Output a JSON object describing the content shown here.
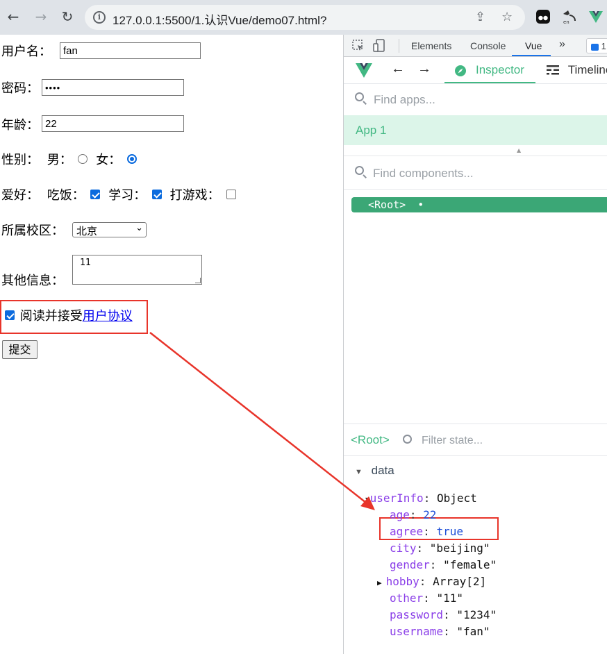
{
  "browser": {
    "url_prefix": "127.0.0.1",
    "url_rest": ":5500/1.认识Vue/demo07.html?"
  },
  "form": {
    "username_label": "用户名：",
    "username_value": "fan",
    "password_label": "密码：",
    "password_value": "••••",
    "age_label": "年龄：",
    "age_value": "22",
    "gender_label": "性别：",
    "male_label": "男：",
    "female_label": "女：",
    "gender_selected": "female",
    "hobby_label": "爱好：",
    "hobbies": [
      {
        "label": "吃饭：",
        "checked": true
      },
      {
        "label": "学习：",
        "checked": true
      },
      {
        "label": "打游戏：",
        "checked": false
      }
    ],
    "campus_label": "所属校区：",
    "campus_value": "北京",
    "other_label": "其他信息：",
    "other_value": "11",
    "agree_text": "阅读并接受",
    "agree_link": "用户协议",
    "agree_checked": true,
    "submit_label": "提交"
  },
  "devtools": {
    "tabs": [
      "Elements",
      "Console",
      "Vue"
    ],
    "more_icon": "»",
    "badge": "1",
    "active_tab": "Vue",
    "vue": {
      "inspector_label": "Inspector",
      "timeline_label": "Timeline",
      "find_apps_placeholder": "Find apps...",
      "app_name": "App 1",
      "find_components_placeholder": "Find components...",
      "root_component": "<Root>",
      "root_dot": "•",
      "selected_component": "<Root>",
      "filter_placeholder": "Filter state...",
      "section": "data",
      "object_key": "userInfo",
      "object_type": "Object",
      "fields": [
        {
          "key": "age",
          "value": "22",
          "kind": "num"
        },
        {
          "key": "agree",
          "value": "true",
          "kind": "bool"
        },
        {
          "key": "city",
          "value": "\"beijing\"",
          "kind": "str"
        },
        {
          "key": "gender",
          "value": "\"female\"",
          "kind": "str"
        },
        {
          "key": "hobby",
          "value": "Array[2]",
          "kind": "arr"
        },
        {
          "key": "other",
          "value": "\"11\"",
          "kind": "str"
        },
        {
          "key": "password",
          "value": "\"1234\"",
          "kind": "str"
        },
        {
          "key": "username",
          "value": "\"fan\"",
          "kind": "str"
        }
      ]
    }
  },
  "colors": {
    "vue_green": "#42b883",
    "highlight_red": "#e8342a",
    "checkbox_blue": "#0b6bde"
  }
}
